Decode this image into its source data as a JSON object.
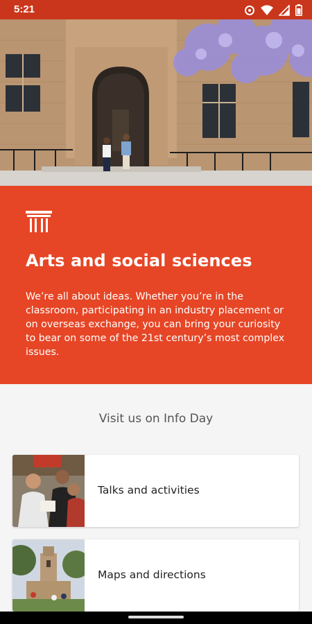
{
  "status_bar": {
    "time": "5:21",
    "icons": [
      "data-saver-icon",
      "wifi-icon",
      "signal-icon",
      "battery-icon"
    ]
  },
  "hero": {
    "image": "sandstone-building-entrance-with-students-and-jacaranda"
  },
  "faculty": {
    "icon": "column-pillar-icon",
    "title": "Arts and social sciences",
    "description": "We’re all about ideas. Whether you’re in the classroom, participating in an industry placement or on overseas exchange, you can bring your curiosity to bear on some of the 21st century’s most complex issues."
  },
  "info_day": {
    "heading": "Visit us on Info Day",
    "cards": [
      {
        "label": "Talks and activities",
        "thumbnail": "students-at-event-photo"
      },
      {
        "label": "Maps and directions",
        "thumbnail": "university-quadrangle-tower-photo"
      }
    ]
  },
  "colors": {
    "status_bar": "#c9361b",
    "accent": "#e64626",
    "background": "#f5f5f5",
    "card": "#ffffff"
  }
}
